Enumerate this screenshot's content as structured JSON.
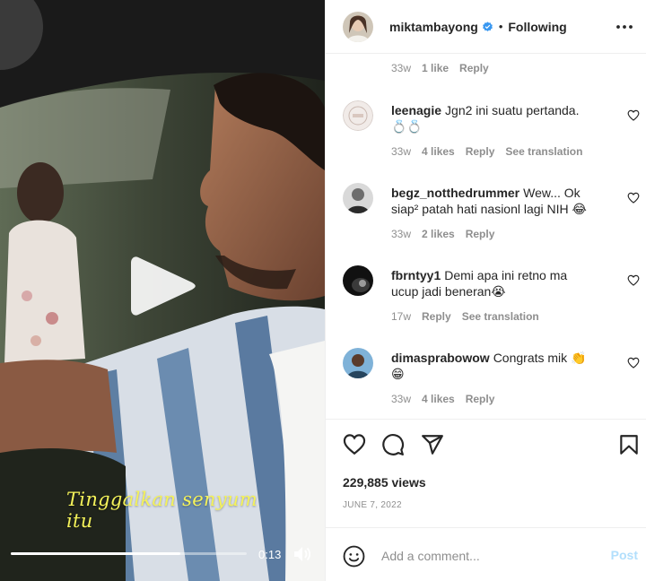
{
  "video": {
    "caption": "Tinggalkan senyum itu",
    "time": "0:13",
    "progress": 0.72
  },
  "header": {
    "username": "miktambayong",
    "separator": "•",
    "follow_label": "Following"
  },
  "comments": [
    {
      "user": "",
      "text": "",
      "time": "33w",
      "likes": "1 like",
      "reply": "Reply",
      "translate": ""
    },
    {
      "user": "leenagie",
      "text": "Jgn2 ini suatu pertanda. 💍💍",
      "time": "33w",
      "likes": "4 likes",
      "reply": "Reply",
      "translate": "See translation"
    },
    {
      "user": "begz_notthedrummer",
      "text": "Wew... Ok siap² patah hati nasionl lagi NIH 😂",
      "time": "33w",
      "likes": "2 likes",
      "reply": "Reply",
      "translate": ""
    },
    {
      "user": "fbrntyy1",
      "text": "Demi apa ini retno ma ucup jadi beneran😭",
      "time": "17w",
      "likes": "",
      "reply": "Reply",
      "translate": "See translation"
    },
    {
      "user": "dimasprabowow",
      "text": "Congrats mik 👏😁",
      "time": "33w",
      "likes": "4 likes",
      "reply": "Reply",
      "translate": ""
    }
  ],
  "post": {
    "views": "229,885 views",
    "date": "JUNE 7, 2022"
  },
  "add_comment": {
    "placeholder": "Add a comment...",
    "post_label": "Post"
  },
  "colors": {
    "caption": "#f4f25a",
    "verified": "#3897f0",
    "muted": "#8e8e8e",
    "post_disabled": "#b2dffc"
  }
}
